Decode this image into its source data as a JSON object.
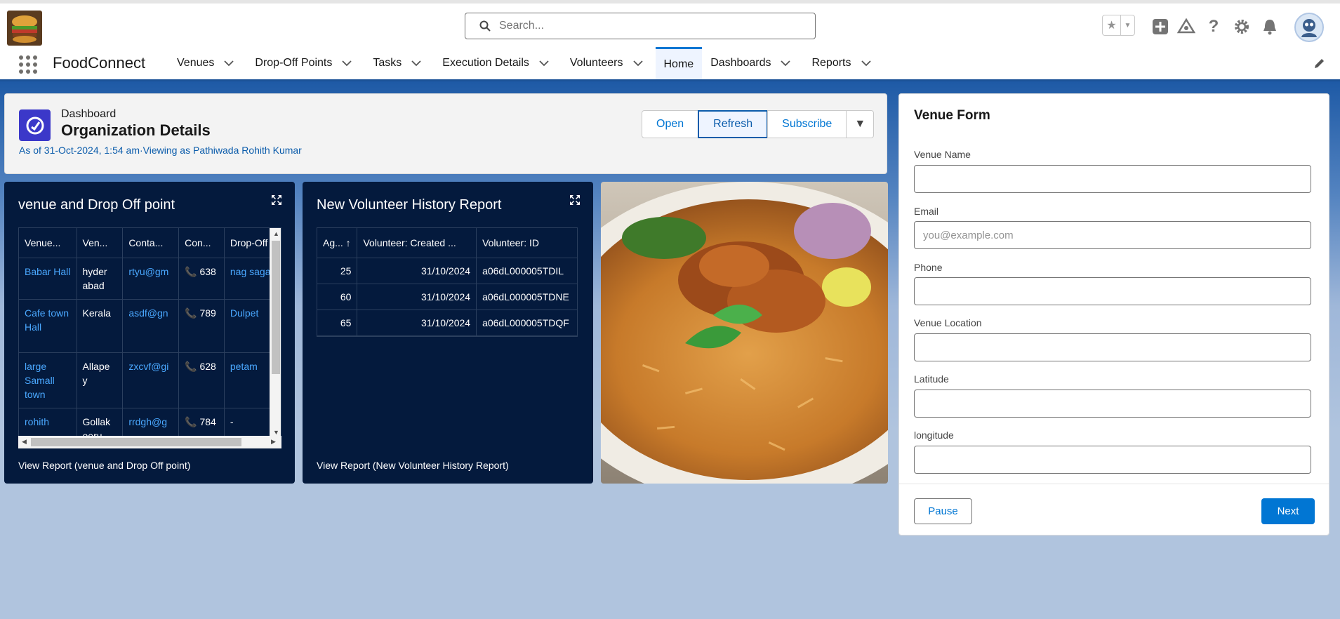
{
  "header": {
    "search_placeholder": "Search..."
  },
  "nav": {
    "app_name": "FoodConnect",
    "items": [
      {
        "label": "Venues"
      },
      {
        "label": "Drop-Off Points"
      },
      {
        "label": "Tasks"
      },
      {
        "label": "Execution Details"
      },
      {
        "label": "Volunteers"
      },
      {
        "label": "Home"
      },
      {
        "label": "Dashboards"
      },
      {
        "label": "Reports"
      }
    ]
  },
  "dashboard": {
    "label": "Dashboard",
    "title": "Organization Details",
    "meta": "As of 31-Oct-2024, 1:54 am·Viewing as Pathiwada Rohith Kumar",
    "buttons": {
      "open": "Open",
      "refresh": "Refresh",
      "subscribe": "Subscribe"
    }
  },
  "widget1": {
    "title": "venue and Drop Off point",
    "columns": [
      "Venue...",
      "Ven...",
      "Conta...",
      "Con...",
      "Drop-Off ..."
    ],
    "rows": [
      {
        "venue": "Babar Hall",
        "city": "hyder abad",
        "email": "rtyu@gm",
        "phone": "📞 638",
        "dropoff": "nag sagar"
      },
      {
        "venue": "Cafe town Hall",
        "city": "Kerala",
        "email": "asdf@gn",
        "phone": "📞 789",
        "dropoff": "Dulpet"
      },
      {
        "venue": "large Samall town",
        "city": "Allape y",
        "email": "zxcvf@gi",
        "phone": "📞 628",
        "dropoff": "petam"
      },
      {
        "venue": "rohith",
        "city": "Gollak oeru",
        "email": "rrdgh@g",
        "phone": "📞 784",
        "dropoff": "-"
      }
    ],
    "view_report": "View Report (venue and Drop Off point)"
  },
  "widget2": {
    "title": "New Volunteer History Report",
    "columns": [
      "Ag... ↑",
      "Volunteer: Created ...",
      "Volunteer: ID"
    ],
    "rows": [
      {
        "age": "25",
        "created": "31/10/2024",
        "id": "a06dL000005TDIL"
      },
      {
        "age": "60",
        "created": "31/10/2024",
        "id": "a06dL000005TDNE"
      },
      {
        "age": "65",
        "created": "31/10/2024",
        "id": "a06dL000005TDQF"
      }
    ],
    "view_report": "View Report (New Volunteer History Report)"
  },
  "form": {
    "title": "Venue Form",
    "fields": [
      {
        "label": "Venue Name",
        "placeholder": "",
        "value": ""
      },
      {
        "label": "Email",
        "placeholder": "you@example.com",
        "value": ""
      },
      {
        "label": "Phone",
        "placeholder": "",
        "value": ""
      },
      {
        "label": "Venue Location",
        "placeholder": "",
        "value": ""
      },
      {
        "label": "Latitude",
        "placeholder": "",
        "value": ""
      },
      {
        "label": "longitude",
        "placeholder": "",
        "value": ""
      }
    ],
    "pause_label": "Pause",
    "next_label": "Next"
  },
  "colors": {
    "brand_blue": "#0176d3",
    "widget_bg": "#041a3d",
    "dashboard_icon": "#3b38c9"
  },
  "icons": [
    "search-icon",
    "star-icon",
    "add-icon",
    "trailhead-icon",
    "help-icon",
    "gear-icon",
    "bell-icon",
    "avatar",
    "waffle-icon",
    "pencil-icon",
    "expand-icon",
    "phone-icon"
  ]
}
